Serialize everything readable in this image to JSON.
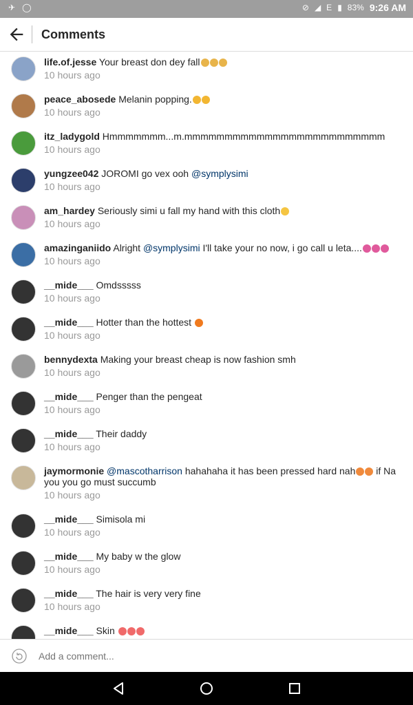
{
  "status_bar": {
    "battery": "83%",
    "time": "9:26 AM",
    "network": "E"
  },
  "header": {
    "title": "Comments"
  },
  "comments": [
    {
      "user": "life.of.jesse",
      "parts": [
        {
          "t": "Your breast don dey fall"
        }
      ],
      "emoji": [
        "#e8b44a",
        "#e8b44a",
        "#e8b44a"
      ],
      "time": "10 hours ago",
      "avatar": "#8aa3c8"
    },
    {
      "user": "peace_abosede",
      "parts": [
        {
          "t": "Melanin popping."
        }
      ],
      "emoji": [
        "#f2b632",
        "#f2b632"
      ],
      "time": "10 hours ago",
      "avatar": "#b07a4a"
    },
    {
      "user": "itz_ladygold",
      "parts": [
        {
          "t": "Hmmmmmmm...m.mmmmmmmmmmmmmmmmmmmmmmmmm"
        }
      ],
      "emoji": [],
      "time": "10 hours ago",
      "avatar": "#4a9b3c"
    },
    {
      "user": "yungzee042",
      "parts": [
        {
          "t": "JOROMI go vex ooh "
        },
        {
          "m": "@symplysimi"
        }
      ],
      "emoji": [],
      "time": "10 hours ago",
      "avatar": "#2c3e6b"
    },
    {
      "user": "am_hardey",
      "parts": [
        {
          "t": "Seriously simi u fall my hand with this cloth"
        }
      ],
      "emoji": [
        "#f5c542"
      ],
      "time": "10 hours ago",
      "avatar": "#c98fb8"
    },
    {
      "user": "amazinganiido",
      "parts": [
        {
          "t": "Alright "
        },
        {
          "m": "@symplysimi"
        },
        {
          "t": " I'll take your no now, i go call u leta...."
        }
      ],
      "emoji": [
        "#e05a9c",
        "#e05a9c",
        "#e05a9c"
      ],
      "time": "10 hours ago",
      "avatar": "#3b6ea5"
    },
    {
      "user": "__mide___",
      "parts": [
        {
          "t": "Omdsssss"
        }
      ],
      "emoji": [],
      "time": "10 hours ago",
      "avatar": "#333333"
    },
    {
      "user": "__mide___",
      "parts": [
        {
          "t": "Hotter than the hottest "
        }
      ],
      "emoji": [
        "#f07a1e"
      ],
      "time": "10 hours ago",
      "avatar": "#333333"
    },
    {
      "user": "bennydexta",
      "parts": [
        {
          "t": "Making your breast cheap is now fashion smh"
        }
      ],
      "emoji": [],
      "time": "10 hours ago",
      "avatar": "#9a9a9a"
    },
    {
      "user": "__mide___",
      "parts": [
        {
          "t": "Penger than the pengeat"
        }
      ],
      "emoji": [],
      "time": "10 hours ago",
      "avatar": "#333333"
    },
    {
      "user": "__mide___",
      "parts": [
        {
          "t": "Their daddy"
        }
      ],
      "emoji": [],
      "time": "10 hours ago",
      "avatar": "#333333"
    },
    {
      "user": "jaymormonie",
      "parts": [
        {
          "m": "@mascotharrison"
        },
        {
          "t": " hahahaha it has been pressed hard nah"
        },
        {
          "e": [
            "#f08a3c",
            "#f08a3c"
          ]
        },
        {
          "t": " if Na you you go must succumb"
        }
      ],
      "emoji": [],
      "time": "10 hours ago",
      "avatar": "#c8b89a"
    },
    {
      "user": "__mide___",
      "parts": [
        {
          "t": "Simisola mi"
        }
      ],
      "emoji": [],
      "time": "10 hours ago",
      "avatar": "#333333"
    },
    {
      "user": "__mide___",
      "parts": [
        {
          "t": "My baby w the glow"
        }
      ],
      "emoji": [],
      "time": "10 hours ago",
      "avatar": "#333333"
    },
    {
      "user": "__mide___",
      "parts": [
        {
          "t": "The hair is very very fine"
        }
      ],
      "emoji": [],
      "time": "10 hours ago",
      "avatar": "#333333"
    },
    {
      "user": "__mide___",
      "parts": [
        {
          "t": "Skin "
        }
      ],
      "emoji": [
        "#f06a6a",
        "#f06a6a",
        "#f06a6a"
      ],
      "time": "",
      "avatar": "#333333"
    }
  ],
  "composer": {
    "placeholder": "Add a comment..."
  }
}
